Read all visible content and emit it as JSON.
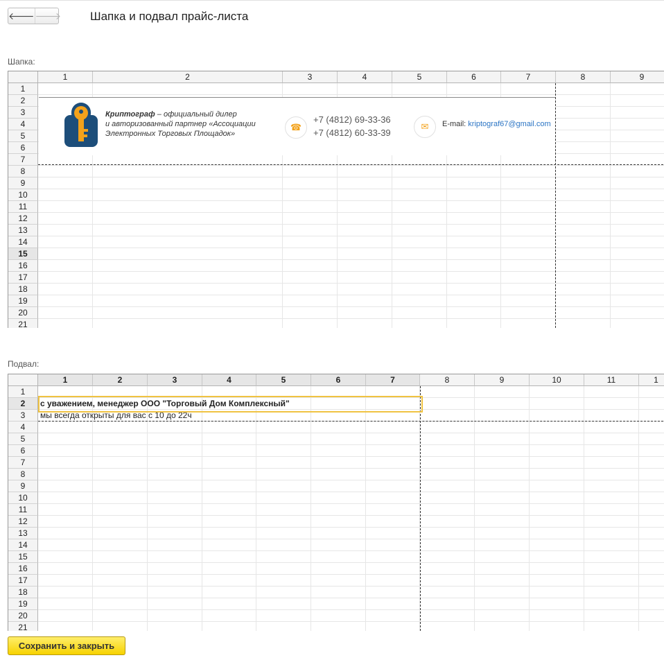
{
  "window": {
    "title": "Шапка и подвал прайс-листа"
  },
  "nav": {
    "back_icon": "arrow-left-icon",
    "forward_icon": "arrow-right-icon",
    "back_glyph": "🡐",
    "forward_glyph": "🡒"
  },
  "header_section": {
    "label": "Шапка:",
    "columns": [
      "1",
      "2",
      "3",
      "4",
      "5",
      "6",
      "7",
      "8",
      "9"
    ],
    "rows": [
      "1",
      "2",
      "3",
      "4",
      "5",
      "6",
      "7",
      "8",
      "9",
      "10",
      "11",
      "12",
      "13",
      "14",
      "15",
      "16",
      "17",
      "18",
      "19",
      "20",
      "21"
    ],
    "selected_row": "15",
    "banner": {
      "company_name": "Криптограф",
      "description_line1": " – официальный дилер",
      "description_line2": "и авторизованный партнер «Ассоциации",
      "description_line3": "Электронных Торговых Площадок»",
      "phone_icon": "phone-icon",
      "phone1": "+7 (4812) 69-33-36",
      "phone2": "+7 (4812) 60-33-39",
      "mail_icon": "mail-icon",
      "email_label": "E-mail: ",
      "email_value": "kriptograf67@gmail.com",
      "accent_color": "#f3a21b",
      "logo_color": "#1d4e7a"
    }
  },
  "footer_section": {
    "label": "Подвал:",
    "columns": [
      "1",
      "2",
      "3",
      "4",
      "5",
      "6",
      "7",
      "8",
      "9",
      "10",
      "11",
      "1"
    ],
    "rows": [
      "1",
      "2",
      "3",
      "4",
      "5",
      "6",
      "7",
      "8",
      "9",
      "10",
      "11",
      "12",
      "13",
      "14",
      "15",
      "16",
      "17",
      "18",
      "19",
      "20",
      "21"
    ],
    "selected_row": "2",
    "line2": "с уважением, менеджер ООО \"Торговый Дом Комплексный\"",
    "line3": "мы всегда открыты для вас с 10 до 22ч"
  },
  "save_button": "Сохранить и закрыть"
}
